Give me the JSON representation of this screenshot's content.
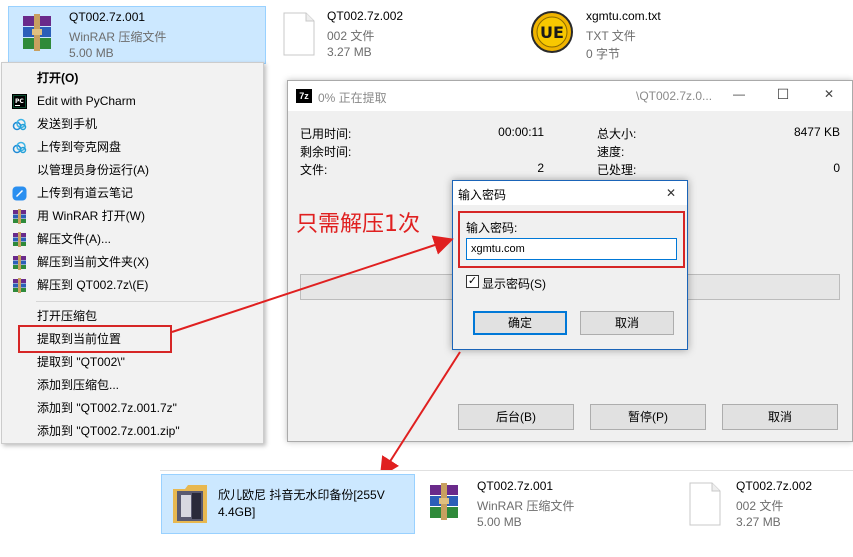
{
  "top_files": [
    {
      "name": "QT002.7z.001",
      "type": "WinRAR 压缩文件",
      "size": "5.00 MB",
      "icon": "winrar-icon"
    },
    {
      "name": "QT002.7z.002",
      "type": "002 文件",
      "size": "3.27 MB",
      "icon": "blank-file-icon"
    },
    {
      "name": "xgmtu.com.txt",
      "type": "TXT 文件",
      "size": "0 字节",
      "icon": "ultraedit-icon"
    }
  ],
  "context_menu": {
    "items": [
      {
        "label": "打开(O)",
        "icon": ""
      },
      {
        "label": "Edit with PyCharm",
        "icon": "pycharm-icon"
      },
      {
        "label": "发送到手机",
        "icon": "cloud-icon"
      },
      {
        "label": "上传到夸克网盘",
        "icon": "cloud-icon"
      },
      {
        "label": "以管理员身份运行(A)",
        "icon": ""
      },
      {
        "label": "上传到有道云笔记",
        "icon": "youdao-note-icon"
      },
      {
        "label": "用 WinRAR 打开(W)",
        "icon": "winrar-icon"
      },
      {
        "label": "解压文件(A)...",
        "icon": "winrar-icon"
      },
      {
        "label": "解压到当前文件夹(X)",
        "icon": "winrar-icon"
      },
      {
        "label": "解压到 QT002.7z\\(E)",
        "icon": "winrar-icon"
      },
      {
        "label": "打开压缩包",
        "icon": ""
      },
      {
        "label": "提取到当前位置",
        "icon": ""
      },
      {
        "label": "提取到 \"QT002\\\"",
        "icon": ""
      },
      {
        "label": "添加到压缩包...",
        "icon": ""
      },
      {
        "label": "添加到 \"QT002.7z.001.7z\"",
        "icon": ""
      },
      {
        "label": "添加到 \"QT002.7z.001.zip\"",
        "icon": ""
      }
    ]
  },
  "extract_window": {
    "app_icon_text": "7z",
    "title": "0% 正在提取",
    "title_file": "\\QT002.7z.0...",
    "controls": {
      "minimize": "—",
      "maximize": "☐",
      "close": "✕"
    },
    "elapsed_label": "已用时间:",
    "elapsed_value": "00:00:11",
    "remaining_label": "剩余时间:",
    "files_label": "文件:",
    "files_value": "2",
    "total_label": "总大小:",
    "total_value": "8477 KB",
    "speed_label": "速度:",
    "processed_label": "已处理:",
    "processed_value": "0",
    "progress": 0.0,
    "buttons": {
      "background": "后台(B)",
      "pause": "暂停(P)",
      "cancel": "取消"
    }
  },
  "password_dialog": {
    "title": "输入密码",
    "close": "✕",
    "prompt": "输入密码:",
    "value": "xgmtu.com",
    "show_password_label": "显示密码(S)",
    "show_password_checked": true,
    "ok": "确定",
    "cancel": "取消"
  },
  "annotation": {
    "text": "只需解压1次",
    "color": "#e02020"
  },
  "bottom_files": [
    {
      "name": "欣儿欧尼 抖音无水印备份[255V 4.4GB]",
      "icon": "folder-icon"
    },
    {
      "name": "QT002.7z.001",
      "type": "WinRAR 压缩文件",
      "size": "5.00 MB",
      "icon": "winrar-icon"
    },
    {
      "name": "QT002.7z.002",
      "type": "002 文件",
      "size": "3.27 MB",
      "icon": "blank-file-icon"
    }
  ]
}
